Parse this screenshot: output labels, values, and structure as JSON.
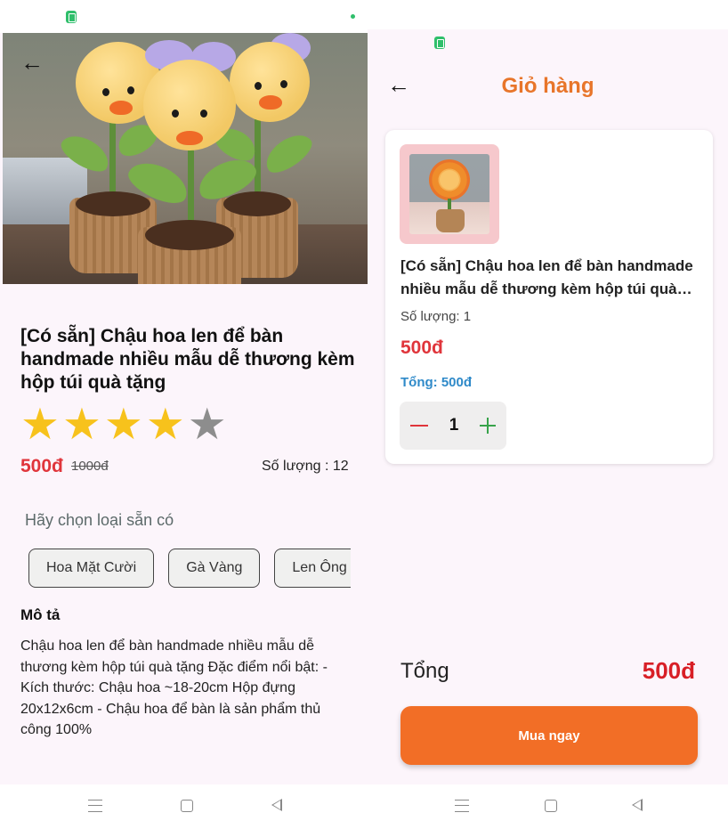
{
  "left_screen": {
    "back_icon": "arrow-left-icon",
    "carousel": {
      "count": 4,
      "active": 3
    },
    "product": {
      "title": "[Có sẵn] Chậu hoa len để bàn handmade nhiều mẫu dễ thương kèm hộp túi quà tặng",
      "rating": {
        "value": 4,
        "max": 5,
        "color_on": "#f7c21c",
        "color_off": "#8d8d8d"
      },
      "price": "500đ",
      "old_price": "1000đ",
      "quantity_label": "Số lượng : 12"
    },
    "variants": {
      "prompt": "Hãy chọn loại sẵn có",
      "options": [
        "Hoa Mặt Cười",
        "Gà Vàng",
        "Len Ông"
      ]
    },
    "description": {
      "heading": "Mô tả",
      "text": "Chậu hoa len để bàn handmade nhiều mẫu dễ thương kèm hộp túi quà tặng Đặc điểm nổi bật: - Kích thước:  Chậu hoa ~18-20cm  Hộp đựng 20x12x6cm - Chậu hoa để bàn là sản phẩm thủ công 100%"
    }
  },
  "right_screen": {
    "back_icon": "arrow-left-icon",
    "title": "Giỏ hàng",
    "cart_item": {
      "name": "[Có sẵn] Chậu hoa len để bàn handmade nhiều mẫu dễ thương kèm hộp túi quà tặng",
      "quantity_text": "Số lượng: 1",
      "price": "500đ",
      "total_text": "Tổng: 500đ",
      "stepper_value": "1"
    },
    "summary": {
      "label": "Tổng",
      "value": "500đ"
    },
    "buy_button": "Mua ngay"
  },
  "system_nav": {
    "icons": [
      "menu-icon",
      "home-square-icon",
      "back-triangle-icon"
    ]
  },
  "colors": {
    "accent_orange": "#f26e26",
    "title_orange": "#e8752a",
    "price_red": "#e0353b",
    "total_blue": "#2f8ac9",
    "screen_bg": "#fcf5fb"
  }
}
